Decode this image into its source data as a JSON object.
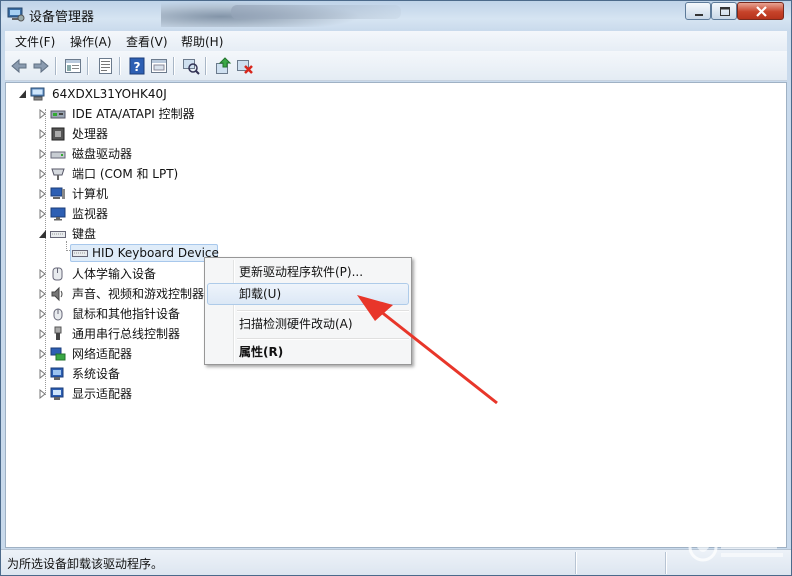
{
  "window": {
    "title": "设备管理器"
  },
  "menu": {
    "items": [
      {
        "label": "文件(F)"
      },
      {
        "label": "操作(A)"
      },
      {
        "label": "查看(V)"
      },
      {
        "label": "帮助(H)"
      }
    ]
  },
  "toolbar": {
    "buttons": [
      {
        "icon": "back-arrow-icon"
      },
      {
        "icon": "forward-arrow-icon"
      },
      {
        "icon": "show-hide-tree-icon"
      },
      {
        "icon": "properties-icon"
      },
      {
        "icon": "help-icon"
      },
      {
        "icon": "view-icon"
      },
      {
        "icon": "scan-hardware-icon"
      },
      {
        "icon": "update-driver-icon"
      },
      {
        "icon": "uninstall-icon"
      }
    ]
  },
  "tree": {
    "root": "64XDXL31YOHK40J",
    "categories": [
      {
        "label": "IDE ATA/ATAPI 控制器",
        "icon": "ide-controller-icon",
        "expanded": false
      },
      {
        "label": "处理器",
        "icon": "processor-icon",
        "expanded": false
      },
      {
        "label": "磁盘驱动器",
        "icon": "disk-drive-icon",
        "expanded": false
      },
      {
        "label": "端口 (COM 和 LPT)",
        "icon": "port-icon",
        "expanded": false
      },
      {
        "label": "计算机",
        "icon": "computer-icon",
        "expanded": false
      },
      {
        "label": "监视器",
        "icon": "monitor-icon",
        "expanded": false
      },
      {
        "label": "键盘",
        "icon": "keyboard-icon",
        "expanded": true
      },
      {
        "label": "人体学输入设备",
        "icon": "hid-icon",
        "expanded": false
      },
      {
        "label": "声音、视频和游戏控制器",
        "icon": "sound-icon",
        "expanded": false
      },
      {
        "label": "鼠标和其他指针设备",
        "icon": "mouse-icon",
        "expanded": false
      },
      {
        "label": "通用串行总线控制器",
        "icon": "usb-icon",
        "expanded": false
      },
      {
        "label": "网络适配器",
        "icon": "network-adapter-icon",
        "expanded": false
      },
      {
        "label": "系统设备",
        "icon": "system-device-icon",
        "expanded": false
      },
      {
        "label": "显示适配器",
        "icon": "display-adapter-icon",
        "expanded": false
      }
    ],
    "selected_device": "HID Keyboard Device"
  },
  "context_menu": {
    "items": [
      {
        "label": "更新驱动程序软件(P)...",
        "bold": false
      },
      {
        "label": "卸载(U)",
        "bold": false,
        "highlighted": true
      },
      {
        "label": "扫描检测硬件改动(A)",
        "bold": false
      },
      {
        "label": "属性(R)",
        "bold": true
      }
    ]
  },
  "status": {
    "text": "为所选设备卸载该驱动程序。"
  },
  "colors": {
    "annotation_arrow": "#e8362a",
    "selection": "#dfecf9"
  }
}
